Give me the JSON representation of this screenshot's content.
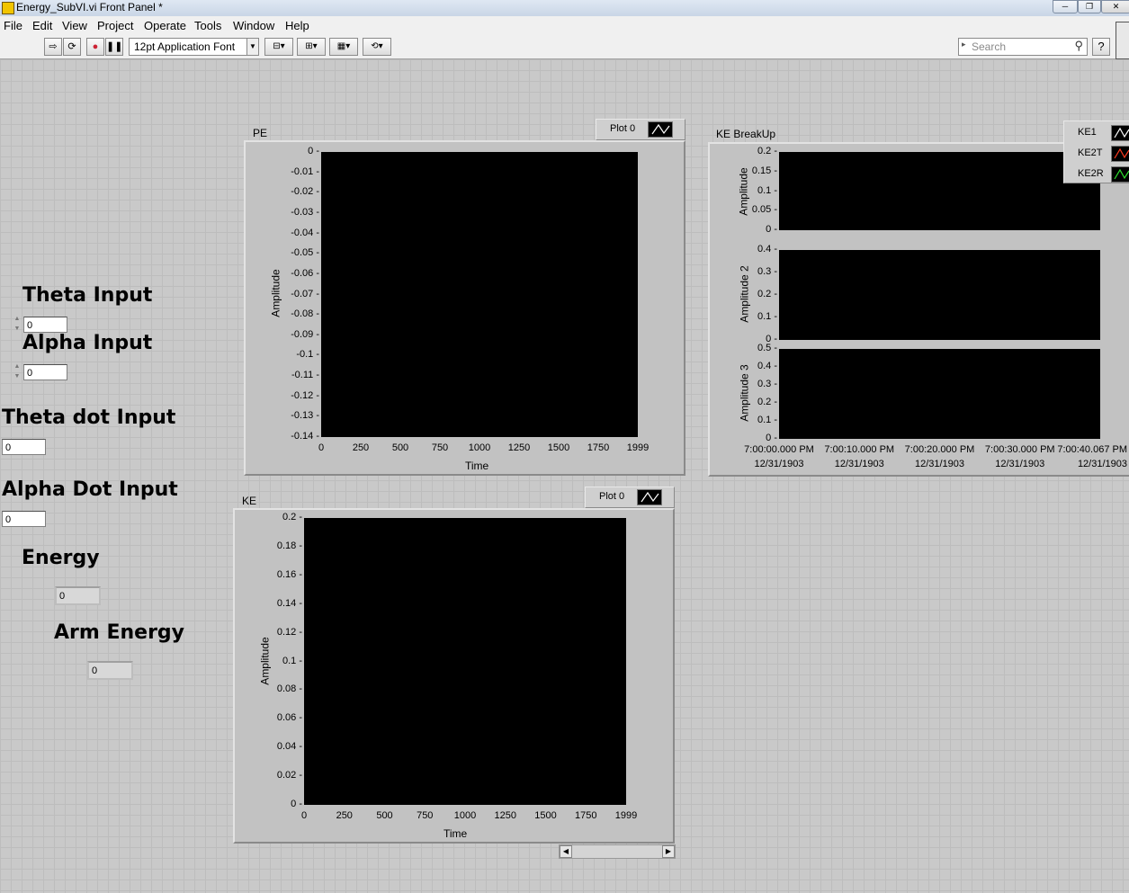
{
  "window": {
    "title": "Energy_SubVI.vi Front Panel *"
  },
  "menu": [
    "File",
    "Edit",
    "View",
    "Project",
    "Operate",
    "Tools",
    "Window",
    "Help"
  ],
  "toolbar": {
    "font": "12pt Application Font",
    "search_placeholder": "Search"
  },
  "controls": {
    "theta_input": {
      "label": "Theta Input",
      "value": "0"
    },
    "alpha_input": {
      "label": "Alpha Input",
      "value": "0"
    },
    "theta_dot_input": {
      "label": "Theta dot Input",
      "value": "0"
    },
    "alpha_dot_input": {
      "label": "Alpha Dot Input",
      "value": "0"
    },
    "energy": {
      "label": "Energy",
      "value": "0"
    },
    "arm_energy": {
      "label": "Arm Energy",
      "value": "0"
    }
  },
  "pe_graph": {
    "label": "PE",
    "legend": "Plot 0",
    "ylabel": "Amplitude",
    "xlabel": "Time",
    "yticks": [
      "0",
      "-0.01",
      "-0.02",
      "-0.03",
      "-0.04",
      "-0.05",
      "-0.06",
      "-0.07",
      "-0.08",
      "-0.09",
      "-0.1",
      "-0.11",
      "-0.12",
      "-0.13",
      "-0.14"
    ],
    "xticks": [
      "0",
      "250",
      "500",
      "750",
      "1000",
      "1250",
      "1500",
      "1750",
      "1999"
    ]
  },
  "ke_graph": {
    "label": "KE",
    "legend": "Plot 0",
    "ylabel": "Amplitude",
    "xlabel": "Time",
    "yticks": [
      "0.2",
      "0.18",
      "0.16",
      "0.14",
      "0.12",
      "0.1",
      "0.08",
      "0.06",
      "0.04",
      "0.02",
      "0"
    ],
    "xticks": [
      "0",
      "250",
      "500",
      "750",
      "1000",
      "1250",
      "1500",
      "1750",
      "1999"
    ]
  },
  "ke_breakup": {
    "label": "KE BreakUp",
    "legend": [
      {
        "name": "KE1",
        "color": "#ffffff"
      },
      {
        "name": "KE2T",
        "color": "#ff3b1f"
      },
      {
        "name": "KE2R",
        "color": "#2ee02e"
      }
    ],
    "plot1": {
      "ylabel": "Amplitude",
      "yticks": [
        "0.2",
        "0.15",
        "0.1",
        "0.05",
        "0"
      ]
    },
    "plot2": {
      "ylabel": "Amplitude 2",
      "yticks": [
        "0.4",
        "0.3",
        "0.2",
        "0.1",
        "0"
      ]
    },
    "plot3": {
      "ylabel": "Amplitude 3",
      "yticks": [
        "0.5",
        "0.4",
        "0.3",
        "0.2",
        "0.1",
        "0"
      ]
    },
    "xticks": [
      {
        "time": "7:00:00.000 PM",
        "date": "12/31/1903"
      },
      {
        "time": "7:00:10.000 PM",
        "date": "12/31/1903"
      },
      {
        "time": "7:00:20.000 PM",
        "date": "12/31/1903"
      },
      {
        "time": "7:00:30.000 PM",
        "date": "12/31/1903"
      },
      {
        "time": "7:00:40.067 PM",
        "date": "12/31/1903"
      }
    ]
  }
}
